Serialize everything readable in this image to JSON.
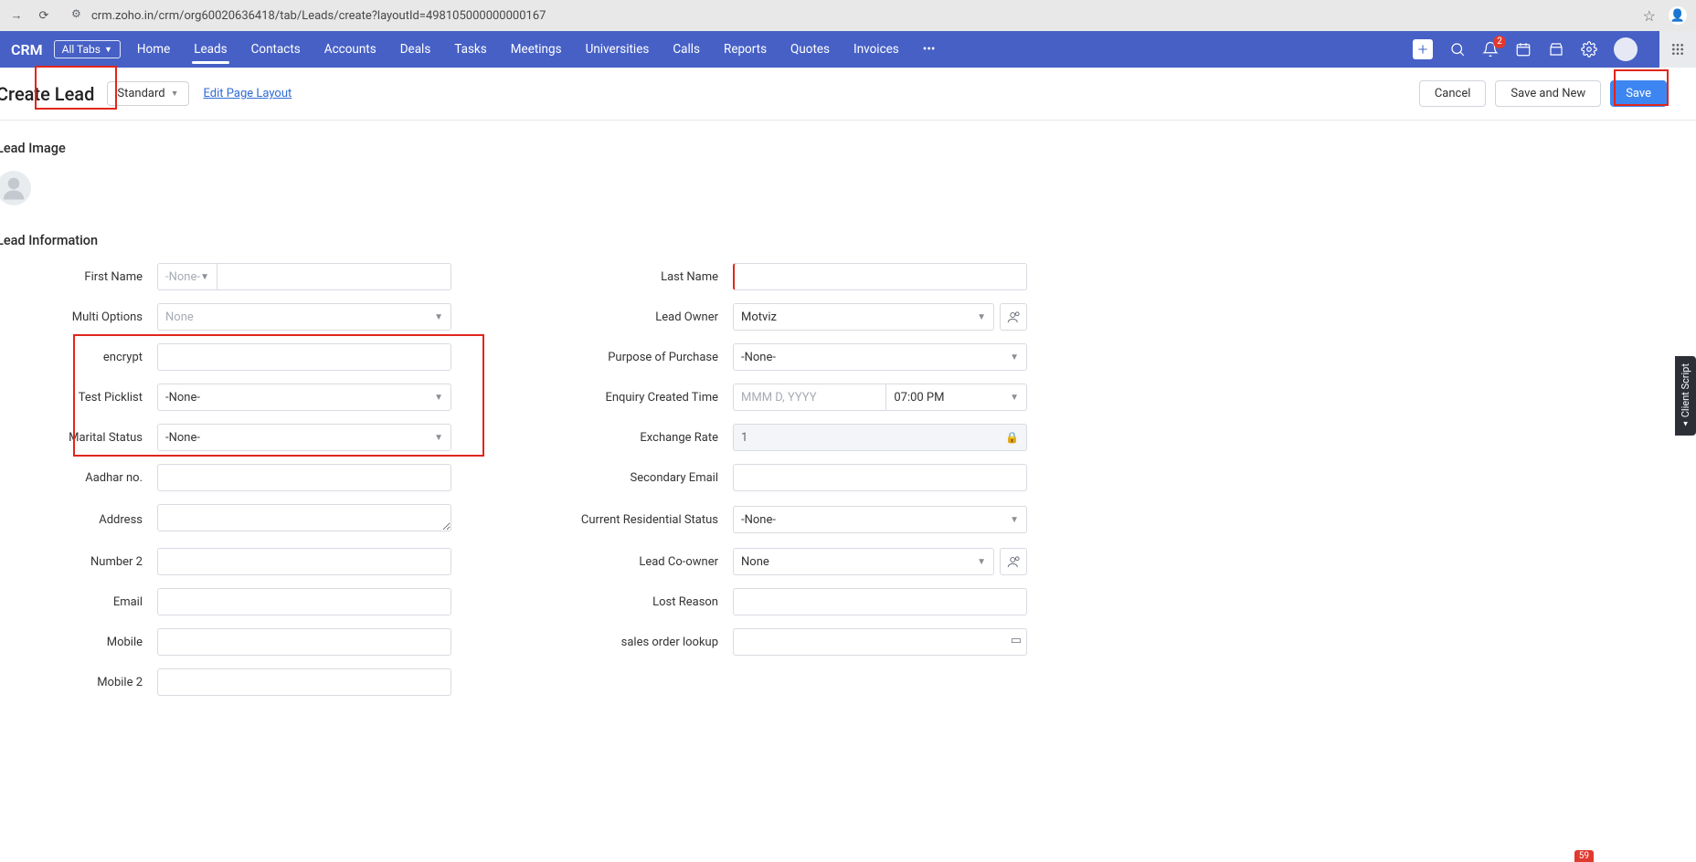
{
  "browser": {
    "url": "crm.zoho.in/crm/org60020636418/tab/Leads/create?layoutId=498105000000000167"
  },
  "nav": {
    "brand": "CRM",
    "allTabs": "All Tabs",
    "items": [
      "Home",
      "Leads",
      "Contacts",
      "Accounts",
      "Deals",
      "Tasks",
      "Meetings",
      "Universities",
      "Calls",
      "Reports",
      "Quotes",
      "Invoices"
    ],
    "activeIndex": 1,
    "notifCount": "2"
  },
  "header": {
    "title": "Create Lead",
    "layout": "Standard",
    "editLink": "Edit Page Layout",
    "cancel": "Cancel",
    "saveNew": "Save and New",
    "save": "Save"
  },
  "sections": {
    "image": "Lead Image",
    "info": "Lead Information"
  },
  "fields": {
    "firstName": {
      "label": "First Name",
      "prefix": "-None-",
      "value": ""
    },
    "multiOptions": {
      "label": "Multi Options",
      "value": "None"
    },
    "encrypt": {
      "label": "encrypt",
      "value": ""
    },
    "testPicklist": {
      "label": "Test Picklist",
      "value": "-None-"
    },
    "maritalStatus": {
      "label": "Marital Status",
      "value": "-None-"
    },
    "aadhar": {
      "label": "Aadhar no.",
      "value": ""
    },
    "address": {
      "label": "Address",
      "value": ""
    },
    "number2": {
      "label": "Number 2",
      "value": ""
    },
    "email": {
      "label": "Email",
      "value": ""
    },
    "mobile": {
      "label": "Mobile",
      "value": ""
    },
    "mobile2": {
      "label": "Mobile 2",
      "value": ""
    },
    "lastName": {
      "label": "Last Name",
      "value": ""
    },
    "leadOwner": {
      "label": "Lead Owner",
      "value": "Motviz"
    },
    "purpose": {
      "label": "Purpose of Purchase",
      "value": "-None-"
    },
    "enquiryTime": {
      "label": "Enquiry Created Time",
      "datePH": "MMM D, YYYY",
      "time": "07:00 PM"
    },
    "exchangeRate": {
      "label": "Exchange Rate",
      "value": "1"
    },
    "secondaryEmail": {
      "label": "Secondary Email",
      "value": ""
    },
    "residential": {
      "label": "Current Residential Status",
      "value": "-None-"
    },
    "coOwner": {
      "label": "Lead Co-owner",
      "value": "None"
    },
    "lostReason": {
      "label": "Lost Reason",
      "value": ""
    },
    "salesOrder": {
      "label": "sales order lookup",
      "value": ""
    }
  },
  "sideTab": "Client Script",
  "bottomCount": "59"
}
